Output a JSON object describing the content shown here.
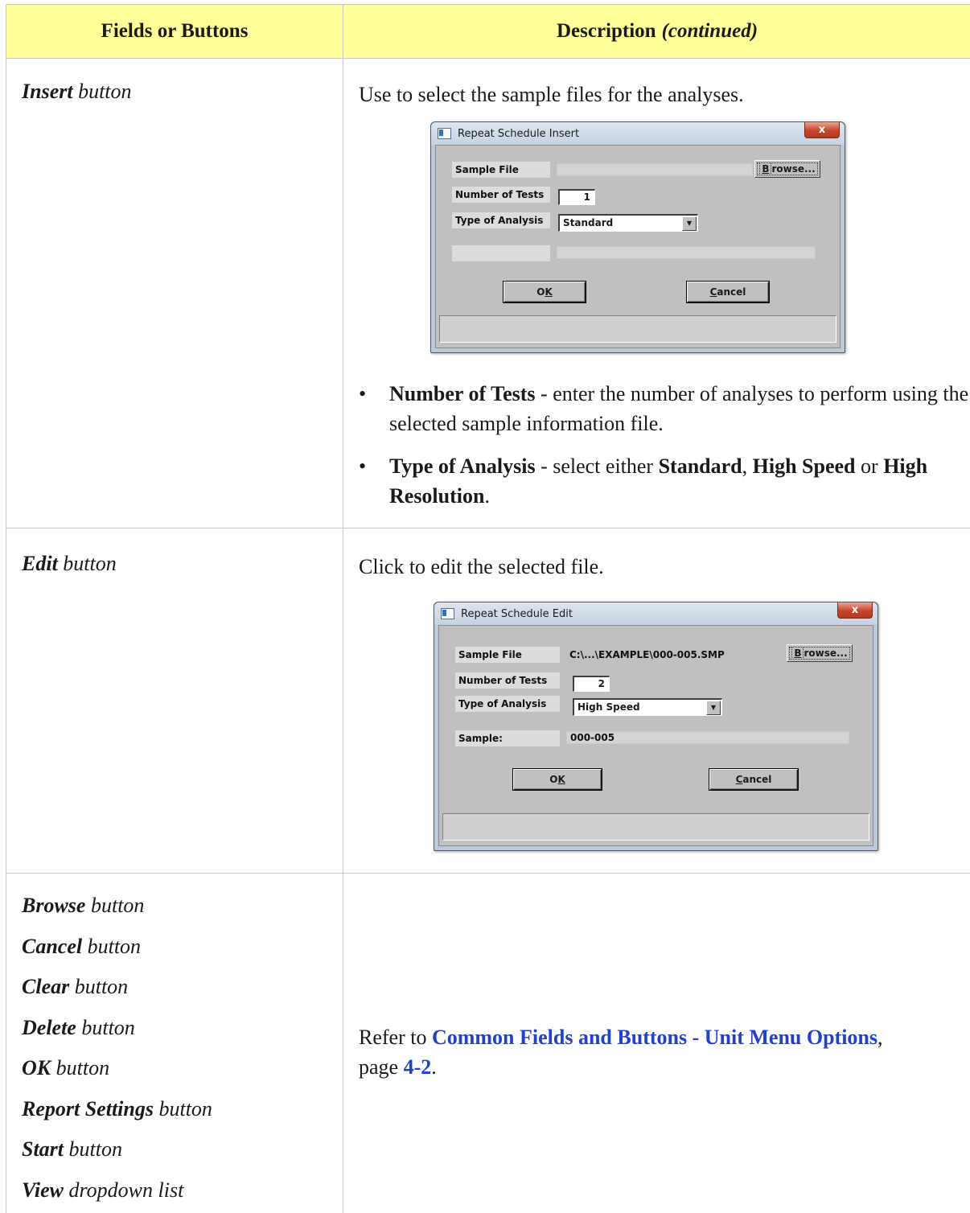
{
  "table": {
    "header_left": "Fields or Buttons",
    "header_right_main": "Description",
    "header_right_suffix": "(continued)",
    "header_color": "#ffff99"
  },
  "insert_row": {
    "field_name": "Insert",
    "field_suffix": "button",
    "description": "Use to select the sample files for the analyses.",
    "dialog": {
      "title": "Repeat Schedule Insert",
      "close_icon": "close-icon",
      "sample_file_label": "Sample File",
      "sample_file_value": "",
      "browse_label": "Browse...",
      "number_of_tests_label": "Number of Tests",
      "number_of_tests_value": "1",
      "type_of_analysis_label": "Type of Analysis",
      "type_of_analysis_value": "Standard",
      "ok_label": "OK",
      "cancel_label": "Cancel"
    },
    "bullets": [
      {
        "term": "Number of Tests",
        "text": " - enter the number of analyses  to perform using the selected sample information file."
      },
      {
        "term": "Type of Analysis",
        "text": " - select either "
      }
    ],
    "analysis_options": [
      "Standard",
      "High Speed",
      "High Resolution"
    ],
    "sep1": ", ",
    "sep2": " or ",
    "end": "."
  },
  "edit_row": {
    "field_name": "Edit",
    "field_suffix": "button",
    "description": "Click to edit the selected file.",
    "dialog": {
      "title": "Repeat Schedule Edit",
      "close_icon": "close-icon",
      "sample_file_label": "Sample File",
      "sample_file_value": "C:\\...\\EXAMPLE\\000-005.SMP",
      "browse_label": "Browse...",
      "number_of_tests_label": "Number of Tests",
      "number_of_tests_value": "2",
      "type_of_analysis_label": "Type of Analysis",
      "type_of_analysis_value": "High Speed",
      "sample_label": "Sample:",
      "sample_value": "000-005",
      "ok_label": "OK",
      "cancel_label": "Cancel"
    }
  },
  "common_row": {
    "items": [
      {
        "name": "Browse",
        "suffix": "button"
      },
      {
        "name": "Cancel",
        "suffix": "button"
      },
      {
        "name": "Clear",
        "suffix": "button"
      },
      {
        "name": "Delete",
        "suffix": "button"
      },
      {
        "name": "OK",
        "suffix": "button"
      },
      {
        "name": "Report Settings",
        "suffix": "button"
      },
      {
        "name": "Start",
        "suffix": "button"
      },
      {
        "name": "View",
        "suffix": "dropdown list"
      }
    ],
    "refer_prefix": "Refer to ",
    "link_text": "Common Fields and Buttons - Unit Menu Options",
    "after_link": ",",
    "page_prefix": "page ",
    "page_link": "4-2",
    "page_suffix": ".",
    "link_color": "#1f3fd6"
  }
}
